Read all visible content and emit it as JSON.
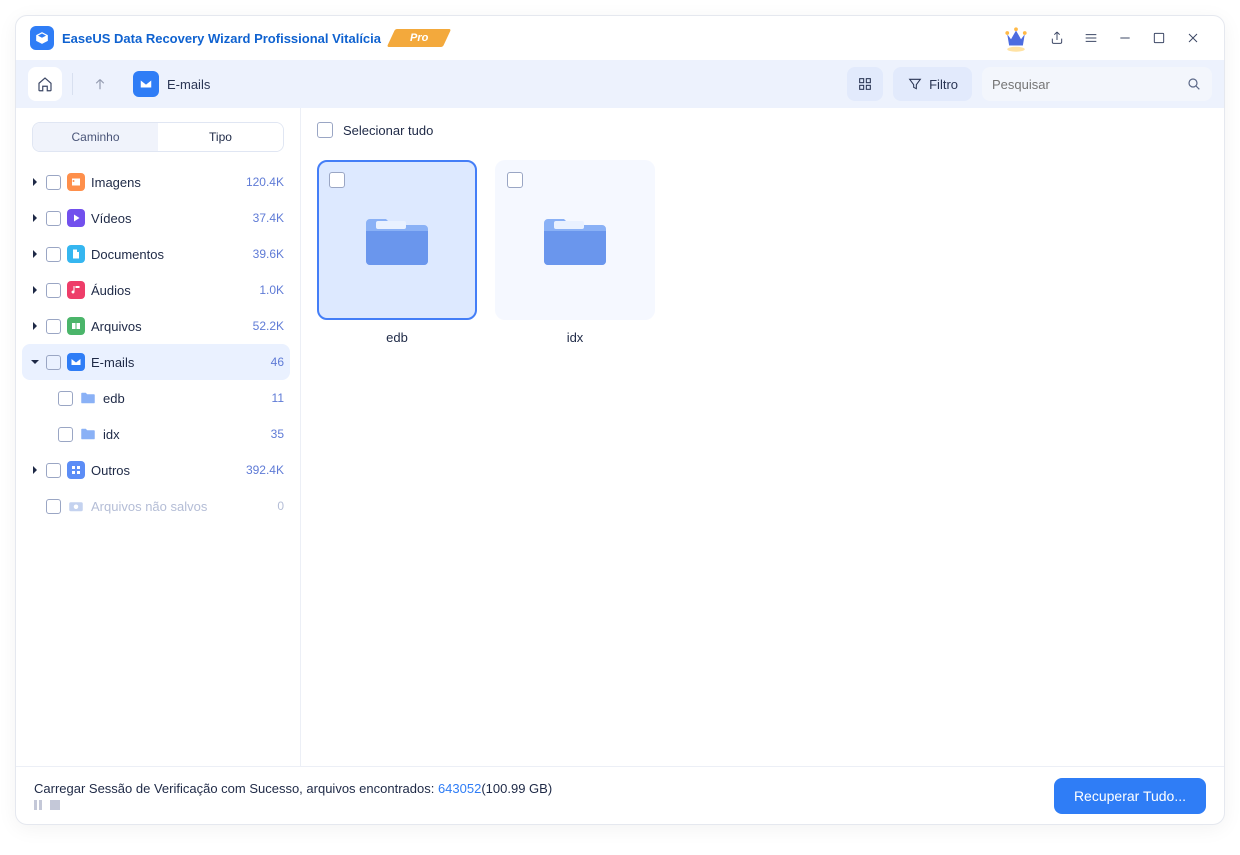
{
  "app": {
    "title": "EaseUS Data Recovery Wizard Profissional Vitalícia",
    "pro_label": "Pro"
  },
  "toolbar": {
    "breadcrumb_label": "E-mails",
    "filter_label": "Filtro",
    "search_placeholder": "Pesquisar"
  },
  "sidebar": {
    "tab_path": "Caminho",
    "tab_type": "Tipo",
    "items": [
      {
        "label": "Imagens",
        "count": "120.4K",
        "icon": "image",
        "color": "#fe8f4b"
      },
      {
        "label": "Vídeos",
        "count": "37.4K",
        "icon": "video",
        "color": "#7250ed"
      },
      {
        "label": "Documentos",
        "count": "39.6K",
        "icon": "document",
        "color": "#35b6f0"
      },
      {
        "label": "Áudios",
        "count": "1.0K",
        "icon": "audio",
        "color": "#ee3d69"
      },
      {
        "label": "Arquivos",
        "count": "52.2K",
        "icon": "archive",
        "color": "#4bb56a"
      },
      {
        "label": "E-mails",
        "count": "46",
        "icon": "email",
        "color": "#2f7df6",
        "selected": true,
        "expanded": true,
        "children": [
          {
            "label": "edb",
            "count": "11"
          },
          {
            "label": "idx",
            "count": "35"
          }
        ]
      },
      {
        "label": "Outros",
        "count": "392.4K",
        "icon": "other",
        "color": "#5c8df6"
      }
    ],
    "unsaved": {
      "label": "Arquivos não salvos",
      "count": "0"
    }
  },
  "content": {
    "select_all_label": "Selecionar tudo",
    "tiles": [
      {
        "name": "edb",
        "selected": true
      },
      {
        "name": "idx",
        "selected": false
      }
    ]
  },
  "footer": {
    "status_prefix": "Carregar Sessão de Verificação com Sucesso, arquivos encontrados: ",
    "status_count": "643052",
    "status_size": "(100.99 GB)",
    "recover_label": "Recuperar Tudo..."
  }
}
